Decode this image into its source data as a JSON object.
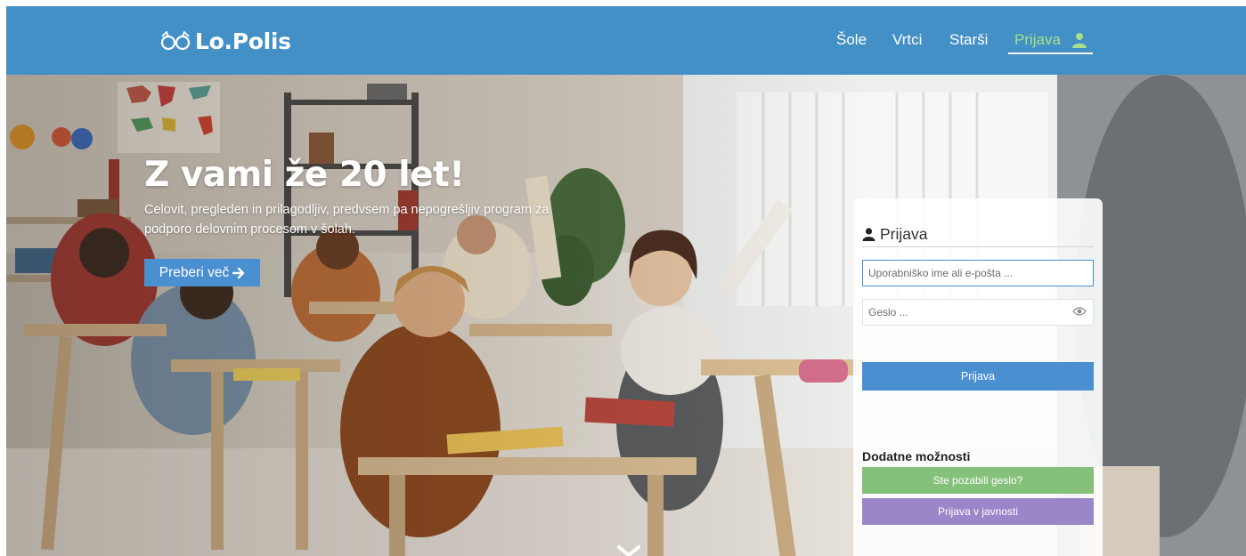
{
  "header": {
    "logo_text": "Lo.Polis",
    "nav": [
      {
        "label": "Šole"
      },
      {
        "label": "Vrtci"
      },
      {
        "label": "Starši"
      },
      {
        "label": "Prijava",
        "active": true
      }
    ]
  },
  "hero": {
    "title": "Z vami že 20 let!",
    "subtitle": "Celovit, pregleden in prilagodljiv, predvsem pa nepogrešljiv program za podporo delovnim procesom v šolah.",
    "cta_label": "Preberi več",
    "scroll_icon": "chevron-down-icon"
  },
  "login": {
    "title": "Prijava",
    "username_placeholder": "Uporabniško ime ali e-pošta ...",
    "password_placeholder": "Geslo ...",
    "submit_label": "Prijava",
    "extra_title": "Dodatne možnosti",
    "forgot_label": "Ste pozabili geslo?",
    "public_label": "Prijava v javnosti"
  },
  "colors": {
    "nav_bg": "#4290c5",
    "nav_active": "#a6e08a",
    "primary": "#4a8fd0",
    "forgot_btn": "#86c17b",
    "public_btn": "#9a86c8"
  },
  "icons": [
    "owl-logo-icon",
    "user-icon",
    "eye-icon",
    "arrow-right-icon",
    "chevron-down-icon"
  ]
}
